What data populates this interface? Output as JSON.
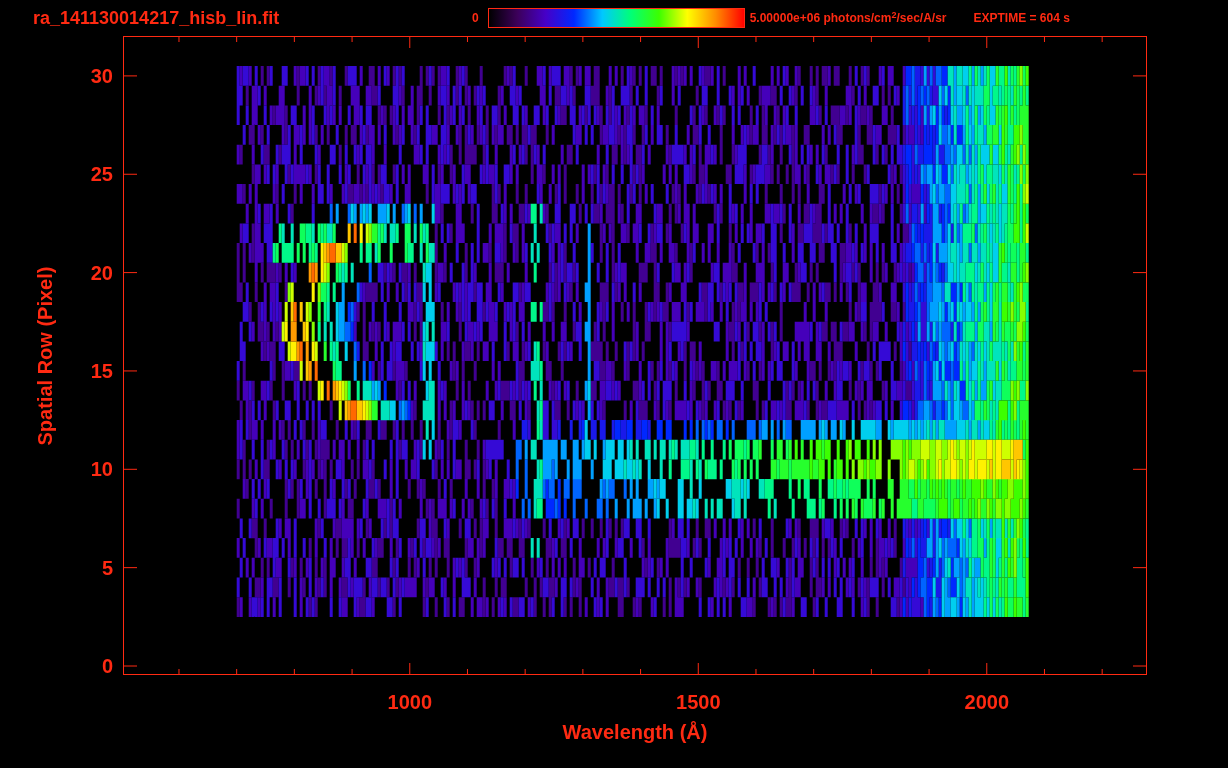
{
  "title": "ra_141130014217_hisb_lin.fit",
  "colorbar": {
    "min_label": "0",
    "max_label": "5.00000e+06 photons/cm$^{2}$/sec/A/sr"
  },
  "exptime": "EXPTIME = 604 s",
  "plot": {
    "xlabel": "Wavelength (Å)",
    "ylabel": "Spatial Row (Pixel)",
    "xticks": [
      "1000",
      "1500",
      "2000"
    ],
    "yticks": [
      "30",
      "25",
      "20",
      "15",
      "10",
      "5",
      "0"
    ]
  }
}
